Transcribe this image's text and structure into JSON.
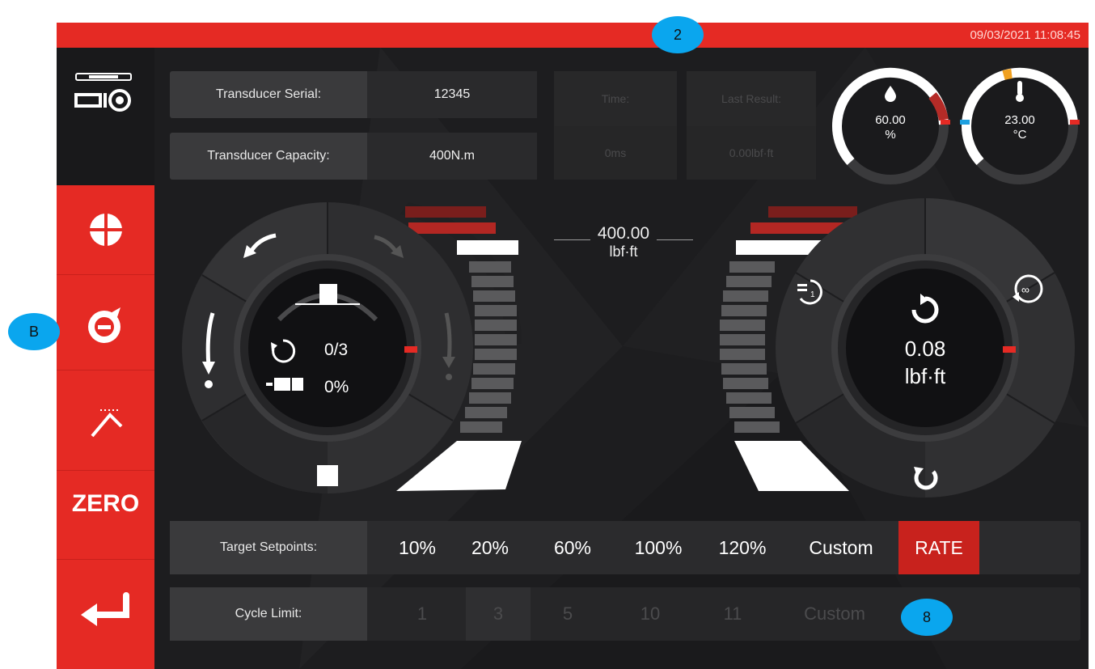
{
  "status_bar": {
    "datetime": "09/03/2021 11:08:45"
  },
  "info": {
    "serial_label": "Transducer Serial:",
    "serial_value": "12345",
    "capacity_label": "Transducer Capacity:",
    "capacity_value": "400N.m",
    "time_label": "Time:",
    "time_value": "0ms",
    "last_result_label": "Last Result:",
    "last_result_value": "0.00lbf·ft"
  },
  "gauges": {
    "humidity": {
      "value": "60.00",
      "unit": "%",
      "icon": "droplet-icon"
    },
    "temperature": {
      "value": "23.00",
      "unit": "°C",
      "icon": "thermometer-icon"
    }
  },
  "left_dial": {
    "cycles": "0/3",
    "memory": "0%"
  },
  "center": {
    "capacity_value": "400.00",
    "capacity_unit": "lbf·ft"
  },
  "right_dial": {
    "value": "0.08",
    "unit": "lbf·ft"
  },
  "sidebar": {
    "zero_label": "ZERO"
  },
  "target_setpoints": {
    "label": "Target Setpoints:",
    "options": [
      "10%",
      "20%",
      "60%",
      "100%",
      "120%",
      "Custom",
      "RATE"
    ],
    "selected": "RATE"
  },
  "cycle_limit": {
    "label": "Cycle Limit:",
    "options": [
      "1",
      "3",
      "5",
      "10",
      "11",
      "Custom"
    ],
    "selected": "3"
  },
  "callouts": {
    "top": "2",
    "left": "B",
    "bottom": "8"
  },
  "colors": {
    "accent": "#e52a24",
    "background": "#1d1d1f",
    "callout": "#0aa6ee"
  }
}
